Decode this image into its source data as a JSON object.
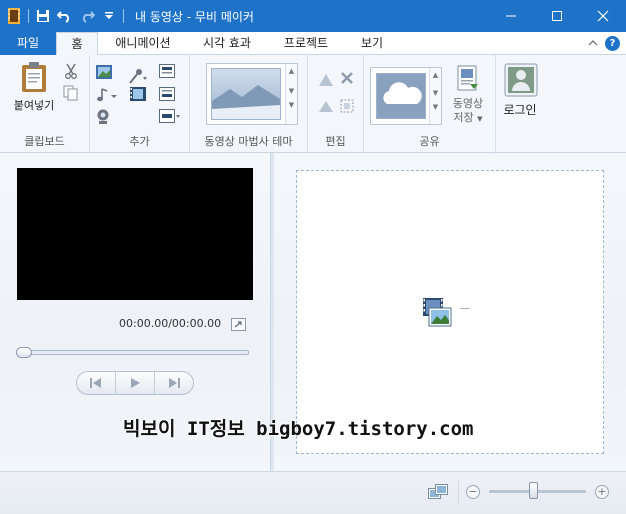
{
  "window": {
    "title": "내 동영상 - 무비 메이커",
    "minimize": "—",
    "maximize": "☐",
    "close": "✕"
  },
  "tabs": [
    {
      "label": "파일"
    },
    {
      "label": "홈"
    },
    {
      "label": "애니메이션"
    },
    {
      "label": "시각 효과"
    },
    {
      "label": "프로젝트"
    },
    {
      "label": "보기"
    }
  ],
  "ribbon": {
    "clipboard": {
      "paste_label": "붙여넣기",
      "group_label": "클립보드"
    },
    "add": {
      "group_label": "추가"
    },
    "theme": {
      "group_label": "동영상 마법사 테마"
    },
    "edit": {
      "group_label": "편집"
    },
    "share": {
      "group_label": "공유",
      "save_label_1": "동영상",
      "save_label_2": "저장"
    },
    "login": {
      "label": "로그인"
    }
  },
  "preview": {
    "timecode": "00:00.00/00:00.00",
    "seek_progress": 0
  },
  "watermark": "빅보이 IT정보 bigboy7.tistory.com",
  "statusbar": {
    "zoom_minus": "−",
    "zoom_plus": "+",
    "zoom_level": 0.45
  },
  "colors": {
    "accent": "#1e73c8",
    "ribbon_bg": "#f3f6fa"
  }
}
